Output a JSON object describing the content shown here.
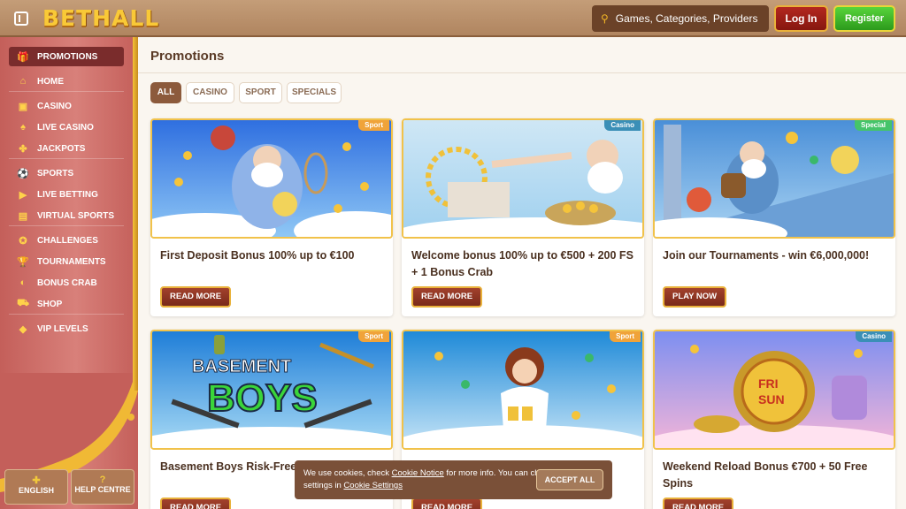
{
  "header": {
    "logo": "BETHALL",
    "search_placeholder": "Games, Categories, Providers",
    "login_label": "Log In",
    "register_label": "Register"
  },
  "sidebar": {
    "items": [
      {
        "label": "PROMOTIONS",
        "icon": "gift-icon",
        "glyph": "🎁",
        "active": true
      },
      {
        "label": "HOME",
        "icon": "home-icon",
        "glyph": "⌂"
      },
      {
        "label": "CASINO",
        "icon": "slot-icon",
        "glyph": "▣"
      },
      {
        "label": "LIVE CASINO",
        "icon": "cards-icon",
        "glyph": "♠"
      },
      {
        "label": "JACKPOTS",
        "icon": "clover-icon",
        "glyph": "✤"
      },
      {
        "label": "SPORTS",
        "icon": "ball-icon",
        "glyph": "⚽"
      },
      {
        "label": "LIVE BETTING",
        "icon": "live-icon",
        "glyph": "▶"
      },
      {
        "label": "VIRTUAL SPORTS",
        "icon": "monitor-icon",
        "glyph": "▤"
      },
      {
        "label": "CHALLENGES",
        "icon": "medal-icon",
        "glyph": "✪"
      },
      {
        "label": "TOURNAMENTS",
        "icon": "trophy-icon",
        "glyph": "🏆"
      },
      {
        "label": "BONUS CRAB",
        "icon": "crab-icon",
        "glyph": "◐"
      },
      {
        "label": "SHOP",
        "icon": "basket-icon",
        "glyph": "⛟"
      },
      {
        "label": "VIP LEVELS",
        "icon": "diamond-icon",
        "glyph": "◆"
      }
    ],
    "language_label": "ENGLISH",
    "help_label": "HELP CENTRE"
  },
  "main": {
    "title": "Promotions",
    "filters": [
      "ALL",
      "CASINO",
      "SPORT",
      "SPECIALS"
    ],
    "cards": [
      {
        "tag": "Sport",
        "tag_color": "#f0a33a",
        "title": "First Deposit Bonus 100% up to €100",
        "button": "READ MORE"
      },
      {
        "tag": "Casino",
        "tag_color": "#3a8fb7",
        "title": "Welcome bonus 100% up to €500 + 200 FS + 1 Bonus Crab",
        "button": "READ MORE"
      },
      {
        "tag": "Special",
        "tag_color": "#45c46a",
        "title": "Join our Tournaments - win €6,000,000!",
        "button": "PLAY NOW"
      },
      {
        "tag": "Sport",
        "tag_color": "#f0a33a",
        "title": "Basement Boys Risk-Free €50",
        "button": "READ MORE"
      },
      {
        "tag": "Sport",
        "tag_color": "#f0a33a",
        "title": "",
        "button": "READ MORE"
      },
      {
        "tag": "Casino",
        "tag_color": "#3a8fb7",
        "title": "Weekend Reload Bonus €700 + 50 Free Spins",
        "button": "READ MORE"
      }
    ],
    "card_art": {
      "basement_line1": "BASEMENT",
      "basement_line2": "BOYS",
      "fri_sun_1": "FRI",
      "fri_sun_2": "SUN"
    }
  },
  "cookie": {
    "text_1": "We use cookies, check ",
    "link_1": "Cookie Notice",
    "text_2": " for more info. You can change these settings in ",
    "link_2": "Cookie Settings",
    "accept_label": "ACCEPT ALL"
  }
}
